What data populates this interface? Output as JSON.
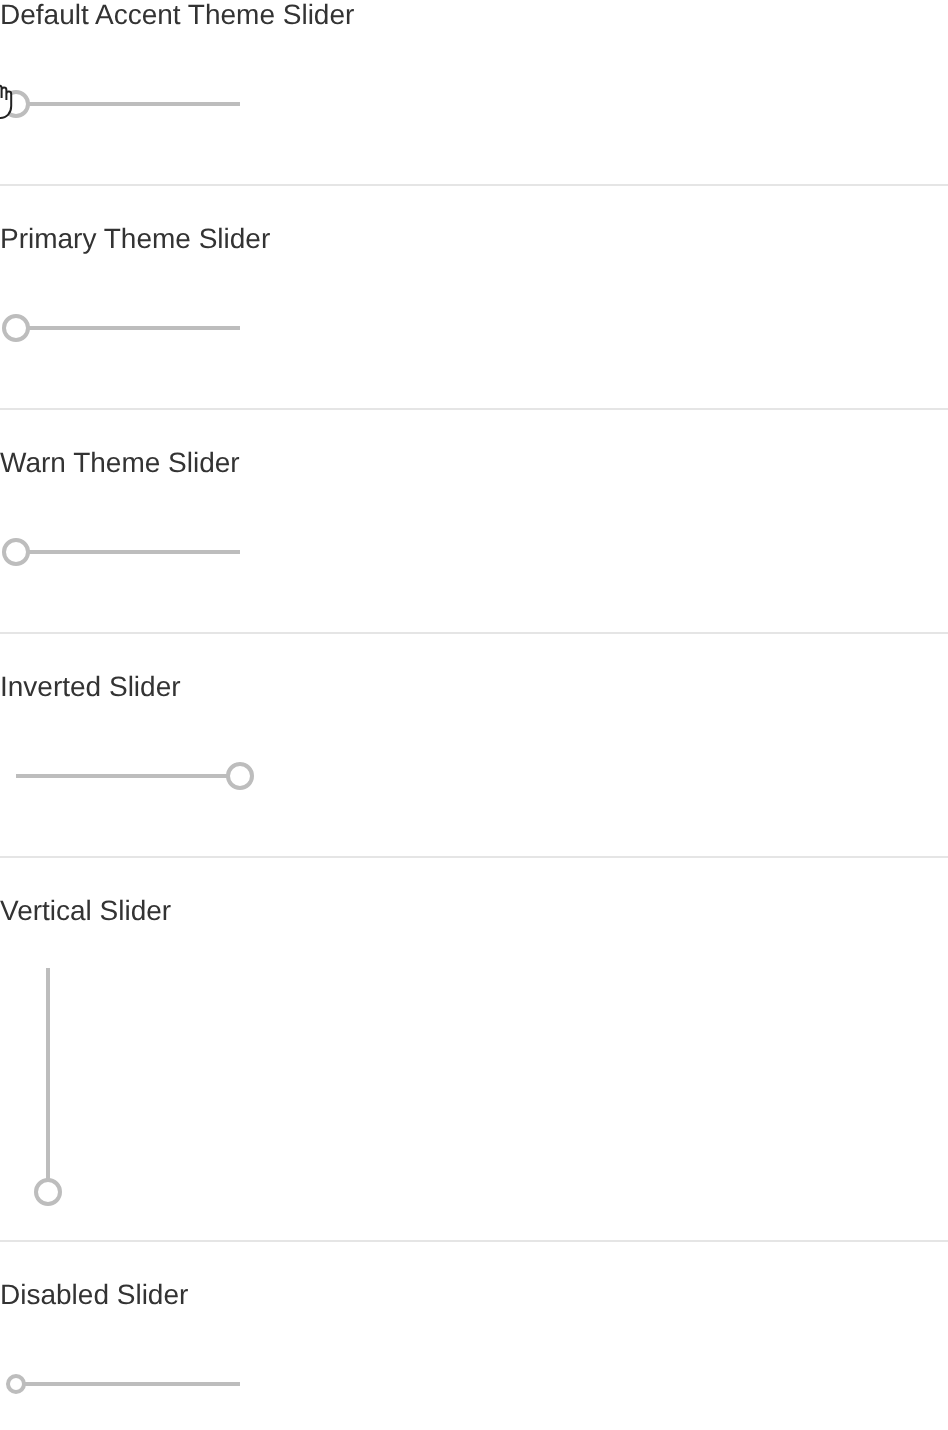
{
  "sliders": [
    {
      "label": "Default Accent Theme Slider",
      "level": 0,
      "kind": "horizontal",
      "inverted": false,
      "disabled": false,
      "hovered": true
    },
    {
      "label": "Primary Theme Slider",
      "level": 0,
      "kind": "horizontal",
      "inverted": false,
      "disabled": false,
      "hovered": false
    },
    {
      "label": "Warn Theme Slider",
      "level": 0,
      "kind": "horizontal",
      "inverted": false,
      "disabled": false,
      "hovered": false
    },
    {
      "label": "Inverted Slider",
      "kind": "horizontal",
      "inverted": true,
      "disabled": false,
      "hovered": false
    },
    {
      "label": "Vertical Slider",
      "level": 0,
      "kind": "vertical",
      "inverted": false,
      "disabled": false,
      "hovered": false
    },
    {
      "label": "Disabled Slider",
      "level": 0,
      "kind": "horizontal",
      "inverted": false,
      "disabled": true,
      "hovered": false
    }
  ]
}
